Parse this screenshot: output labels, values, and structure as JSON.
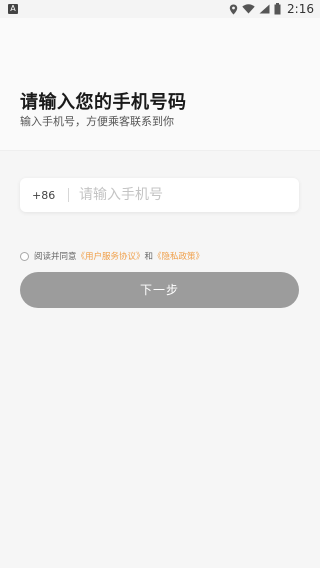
{
  "statusbar": {
    "time": "2:16",
    "left_icon": "A"
  },
  "login": {
    "title": "请输入您的手机号码",
    "subtitle": "输入手机号，方便乘客联系到你",
    "country_code": "+86",
    "phone_placeholder": "请输入手机号",
    "phone_value": "",
    "agree_prefix": "阅读并同意",
    "user_agreement": "《用户服务协议》",
    "and_text": "和",
    "privacy_policy": "《隐私政策》",
    "next_label": "下一步",
    "agree_checked": false
  },
  "colors": {
    "link": "#f0a04b",
    "button_disabled": "#9c9c9c"
  },
  "icons": {
    "status_left": "notification-icon",
    "location": "location-icon",
    "wifi": "wifi-icon",
    "signal": "signal-icon",
    "battery": "battery-icon"
  }
}
